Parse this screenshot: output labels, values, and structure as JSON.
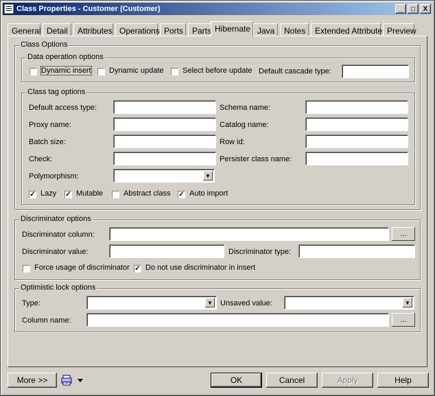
{
  "window": {
    "title": "Class Properties - Customer (Customer)",
    "controls": {
      "minimize": "_",
      "maximize": "□",
      "close": "X"
    }
  },
  "tabs": [
    {
      "label": "General"
    },
    {
      "label": "Detail"
    },
    {
      "label": "Attributes"
    },
    {
      "label": "Operations"
    },
    {
      "label": "Ports"
    },
    {
      "label": "Parts"
    },
    {
      "label": "Hibernate",
      "active": true
    },
    {
      "label": "Java"
    },
    {
      "label": "Notes"
    },
    {
      "label": "Extended Attributes"
    },
    {
      "label": "Preview"
    }
  ],
  "class_options": {
    "title": "Class Options",
    "data_operation": {
      "title": "Data operation options",
      "dynamic_insert": {
        "label": "Dynamic insert",
        "checked": false
      },
      "dynamic_update": {
        "label": "Dynamic update",
        "checked": false
      },
      "select_before_update": {
        "label": "Select before update",
        "checked": false
      },
      "default_cascade_type": {
        "label": "Default cascade type:",
        "value": ""
      }
    },
    "class_tag": {
      "title": "Class tag options",
      "default_access_type": {
        "label": "Default access type:",
        "value": ""
      },
      "schema_name": {
        "label": "Schema name:",
        "value": ""
      },
      "proxy_name": {
        "label": "Proxy name:",
        "value": ""
      },
      "catalog_name": {
        "label": "Catalog name:",
        "value": ""
      },
      "batch_size": {
        "label": "Batch size:",
        "value": ""
      },
      "row_id": {
        "label": "Row id:",
        "value": ""
      },
      "check": {
        "label": "Check:",
        "value": ""
      },
      "persister_class_name": {
        "label": "Persister class name:",
        "value": ""
      },
      "polymorphism": {
        "label": "Polymorphism:",
        "value": ""
      },
      "lazy": {
        "label": "Lazy",
        "checked": true
      },
      "mutable": {
        "label": "Mutable",
        "checked": true
      },
      "abstract_class": {
        "label": "Abstract class",
        "checked": false
      },
      "auto_import": {
        "label": "Auto import",
        "checked": true
      }
    }
  },
  "discriminator": {
    "title": "Discriminator options",
    "column": {
      "label": "Discriminator column:",
      "value": "",
      "button": "..."
    },
    "value": {
      "label": "Discriminator value:",
      "value": ""
    },
    "type": {
      "label": "Discriminator type:",
      "value": ""
    },
    "force_usage": {
      "label": "Force usage of discriminator",
      "checked": false
    },
    "do_not_use_in_insert": {
      "label": "Do not use discriminator in insert",
      "checked": true
    }
  },
  "optimistic_lock": {
    "title": "Optimistic lock options",
    "type": {
      "label": "Type:",
      "value": ""
    },
    "unsaved_value": {
      "label": "Unsaved value:",
      "value": ""
    },
    "column_name": {
      "label": "Column name:",
      "value": "",
      "button": "..."
    }
  },
  "footer": {
    "more": "More >>",
    "ok": "OK",
    "cancel": "Cancel",
    "apply": "Apply",
    "help": "Help"
  },
  "icons": {
    "check_glyph": "✓",
    "dropdown_glyph": "▼"
  }
}
